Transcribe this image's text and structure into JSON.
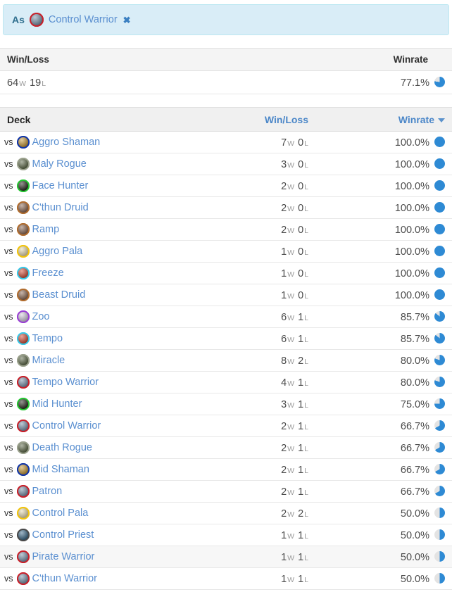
{
  "filter": {
    "as_label": "As",
    "deck_name": "Control Warrior",
    "deck_class": "warrior",
    "deck_icon": "warrior-class-icon",
    "close_label": "✖"
  },
  "summary": {
    "headers": {
      "winloss": "Win/Loss",
      "winrate": "Winrate"
    },
    "wins": "64",
    "wins_suffix": "W",
    "losses": "19",
    "losses_suffix": "L",
    "winrate": "77.1%",
    "winrate_value": 77.1
  },
  "table": {
    "headers": {
      "deck": "Deck",
      "winloss": "Win/Loss",
      "winrate": "Winrate"
    },
    "sort_column": "winrate",
    "sort_direction": "desc",
    "vs_label": "vs",
    "wins_suffix": "W",
    "losses_suffix": "L",
    "rows": [
      {
        "deck": "Aggro Shaman",
        "class": "shaman",
        "icon": "shaman-class-icon",
        "wins": "7",
        "losses": "0",
        "winrate": "100.0%",
        "winrate_value": 100.0,
        "hovered": false
      },
      {
        "deck": "Maly Rogue",
        "class": "rogue",
        "icon": "rogue-class-icon",
        "wins": "3",
        "losses": "0",
        "winrate": "100.0%",
        "winrate_value": 100.0,
        "hovered": false
      },
      {
        "deck": "Face Hunter",
        "class": "hunter",
        "icon": "hunter-class-icon",
        "wins": "2",
        "losses": "0",
        "winrate": "100.0%",
        "winrate_value": 100.0,
        "hovered": false
      },
      {
        "deck": "C'thun Druid",
        "class": "druid",
        "icon": "druid-class-icon",
        "wins": "2",
        "losses": "0",
        "winrate": "100.0%",
        "winrate_value": 100.0,
        "hovered": false
      },
      {
        "deck": "Ramp",
        "class": "druid",
        "icon": "druid-class-icon",
        "wins": "2",
        "losses": "0",
        "winrate": "100.0%",
        "winrate_value": 100.0,
        "hovered": false
      },
      {
        "deck": "Aggro Pala",
        "class": "paladin",
        "icon": "paladin-class-icon",
        "wins": "1",
        "losses": "0",
        "winrate": "100.0%",
        "winrate_value": 100.0,
        "hovered": false
      },
      {
        "deck": "Freeze",
        "class": "mage",
        "icon": "mage-class-icon",
        "wins": "1",
        "losses": "0",
        "winrate": "100.0%",
        "winrate_value": 100.0,
        "hovered": false
      },
      {
        "deck": "Beast Druid",
        "class": "druid",
        "icon": "druid-class-icon",
        "wins": "1",
        "losses": "0",
        "winrate": "100.0%",
        "winrate_value": 100.0,
        "hovered": false
      },
      {
        "deck": "Zoo",
        "class": "warlock",
        "icon": "warlock-class-icon",
        "wins": "6",
        "losses": "1",
        "winrate": "85.7%",
        "winrate_value": 85.7,
        "hovered": false
      },
      {
        "deck": "Tempo",
        "class": "mage",
        "icon": "mage-class-icon",
        "wins": "6",
        "losses": "1",
        "winrate": "85.7%",
        "winrate_value": 85.7,
        "hovered": false
      },
      {
        "deck": "Miracle",
        "class": "rogue",
        "icon": "rogue-class-icon",
        "wins": "8",
        "losses": "2",
        "winrate": "80.0%",
        "winrate_value": 80.0,
        "hovered": false
      },
      {
        "deck": "Tempo Warrior",
        "class": "warrior",
        "icon": "warrior-class-icon",
        "wins": "4",
        "losses": "1",
        "winrate": "80.0%",
        "winrate_value": 80.0,
        "hovered": false
      },
      {
        "deck": "Mid Hunter",
        "class": "hunter",
        "icon": "hunter-class-icon",
        "wins": "3",
        "losses": "1",
        "winrate": "75.0%",
        "winrate_value": 75.0,
        "hovered": false
      },
      {
        "deck": "Control Warrior",
        "class": "warrior",
        "icon": "warrior-class-icon",
        "wins": "2",
        "losses": "1",
        "winrate": "66.7%",
        "winrate_value": 66.7,
        "hovered": false
      },
      {
        "deck": "Death Rogue",
        "class": "rogue",
        "icon": "rogue-class-icon",
        "wins": "2",
        "losses": "1",
        "winrate": "66.7%",
        "winrate_value": 66.7,
        "hovered": false
      },
      {
        "deck": "Mid Shaman",
        "class": "shaman",
        "icon": "shaman-class-icon",
        "wins": "2",
        "losses": "1",
        "winrate": "66.7%",
        "winrate_value": 66.7,
        "hovered": false
      },
      {
        "deck": "Patron",
        "class": "warrior",
        "icon": "warrior-class-icon",
        "wins": "2",
        "losses": "1",
        "winrate": "66.7%",
        "winrate_value": 66.7,
        "hovered": false
      },
      {
        "deck": "Control Pala",
        "class": "paladin",
        "icon": "paladin-class-icon",
        "wins": "2",
        "losses": "2",
        "winrate": "50.0%",
        "winrate_value": 50.0,
        "hovered": false
      },
      {
        "deck": "Control Priest",
        "class": "priest",
        "icon": "priest-class-icon",
        "wins": "1",
        "losses": "1",
        "winrate": "50.0%",
        "winrate_value": 50.0,
        "hovered": false
      },
      {
        "deck": "Pirate Warrior",
        "class": "warrior",
        "icon": "warrior-class-icon",
        "wins": "1",
        "losses": "1",
        "winrate": "50.0%",
        "winrate_value": 50.0,
        "hovered": true
      },
      {
        "deck": "C'thun Warrior",
        "class": "warrior",
        "icon": "warrior-class-icon",
        "wins": "1",
        "losses": "1",
        "winrate": "50.0%",
        "winrate_value": 50.0,
        "hovered": false
      }
    ]
  },
  "colors": {
    "accent_blue": "#2e8ad4",
    "link_blue": "#5a8fd0",
    "banner_bg": "#d9edf7",
    "banner_border": "#bce8f1",
    "pie_remainder": "#e3e3e3",
    "class_rings": {
      "warrior": "#c8202a",
      "shaman": "#1035a8",
      "rogue": "#9aa08c",
      "hunter": "#24c431",
      "druid": "#b06c2e",
      "paladin": "#f2c40c",
      "mage": "#37c8e8",
      "warlock": "#9a3fd4",
      "priest": "#4a4a4a"
    },
    "class_fills": {
      "warrior": "#7d95ad",
      "shaman": "#c79a3a",
      "rogue": "#5f6b4a",
      "hunter": "#2b2b22",
      "druid": "#8e6a55",
      "paladin": "#e8dcb2",
      "mage": "#d4503a",
      "warlock": "#d8cfe2",
      "priest": "#3f6d8c"
    }
  }
}
